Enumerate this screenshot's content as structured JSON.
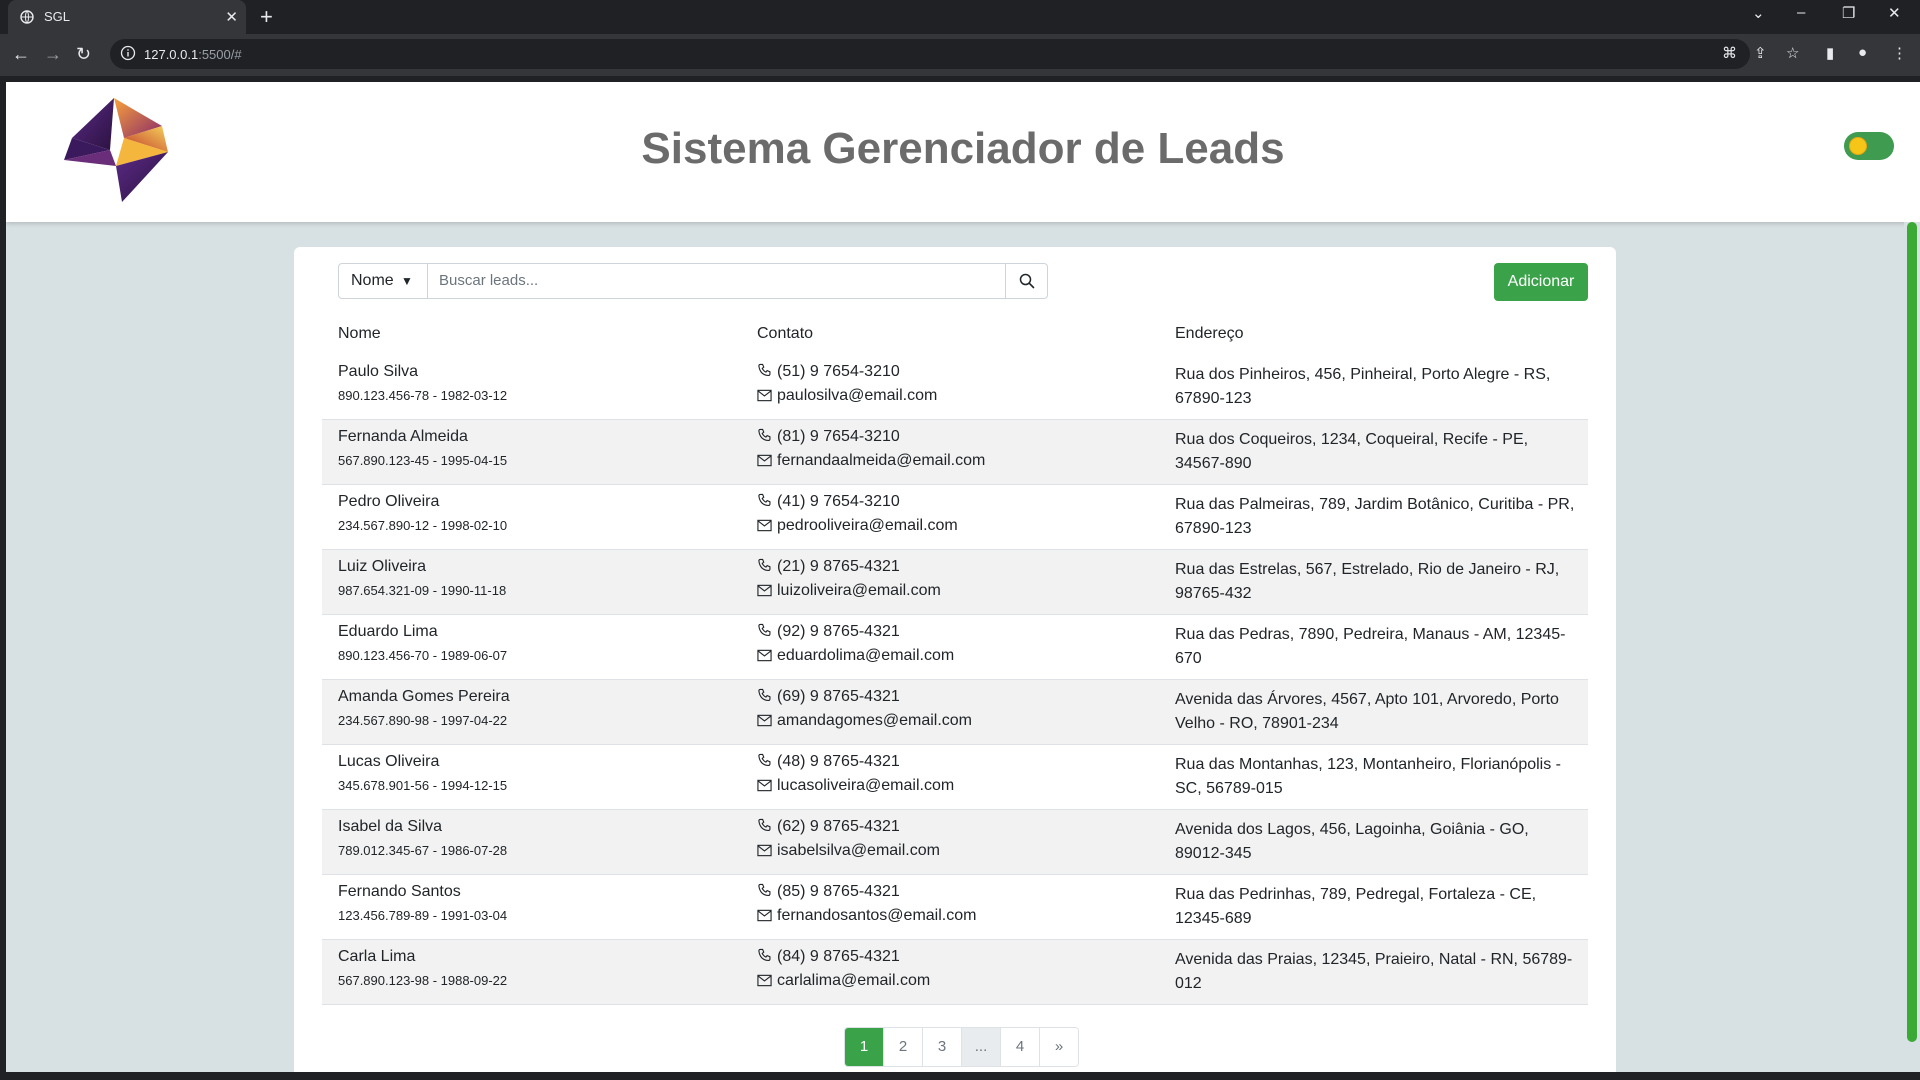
{
  "browser": {
    "tab_title": "SGL",
    "tab_close": "✕",
    "new_tab": "+",
    "url_host": "127.0.0.1",
    "url_rest": ":5500/#"
  },
  "header": {
    "title": "Sistema Gerenciador de Leads"
  },
  "search": {
    "filter_label": "Nome",
    "placeholder": "Buscar leads...",
    "value": ""
  },
  "actions": {
    "add_label": "Adicionar"
  },
  "table": {
    "columns": [
      "Nome",
      "Contato",
      "Endereço"
    ],
    "rows": [
      {
        "name": "Paulo Silva",
        "sub": "890.123.456-78 - 1982-03-12",
        "phone": "(51) 9 7654-3210",
        "email": "paulosilva@email.com",
        "address": "Rua dos Pinheiros, 456, Pinheiral, Porto Alegre - RS, 67890-123"
      },
      {
        "name": "Fernanda Almeida",
        "sub": "567.890.123-45 - 1995-04-15",
        "phone": "(81) 9 7654-3210",
        "email": "fernandaalmeida@email.com",
        "address": "Rua dos Coqueiros, 1234, Coqueiral, Recife - PE, 34567-890"
      },
      {
        "name": "Pedro Oliveira",
        "sub": "234.567.890-12 - 1998-02-10",
        "phone": "(41) 9 7654-3210",
        "email": "pedrooliveira@email.com",
        "address": "Rua das Palmeiras, 789, Jardim Botânico, Curitiba - PR, 67890-123"
      },
      {
        "name": "Luiz Oliveira",
        "sub": "987.654.321-09 - 1990-11-18",
        "phone": "(21) 9 8765-4321",
        "email": "luizoliveira@email.com",
        "address": "Rua das Estrelas, 567, Estrelado, Rio de Janeiro - RJ, 98765-432"
      },
      {
        "name": "Eduardo Lima",
        "sub": "890.123.456-70 - 1989-06-07",
        "phone": "(92) 9 8765-4321",
        "email": "eduardolima@email.com",
        "address": "Rua das Pedras, 7890, Pedreira, Manaus - AM, 12345-670"
      },
      {
        "name": "Amanda Gomes Pereira",
        "sub": "234.567.890-98 - 1997-04-22",
        "phone": "(69) 9 8765-4321",
        "email": "amandagomes@email.com",
        "address": "Avenida das Árvores, 4567, Apto 101, Arvoredo, Porto Velho - RO, 78901-234"
      },
      {
        "name": "Lucas Oliveira",
        "sub": "345.678.901-56 - 1994-12-15",
        "phone": "(48) 9 8765-4321",
        "email": "lucasoliveira@email.com",
        "address": "Rua das Montanhas, 123, Montanheiro, Florianópolis - SC, 56789-015"
      },
      {
        "name": "Isabel da Silva",
        "sub": "789.012.345-67 - 1986-07-28",
        "phone": "(62) 9 8765-4321",
        "email": "isabelsilva@email.com",
        "address": "Avenida dos Lagos, 456, Lagoinha, Goiânia - GO, 89012-345"
      },
      {
        "name": "Fernando Santos",
        "sub": "123.456.789-89 - 1991-03-04",
        "phone": "(85) 9 8765-4321",
        "email": "fernandosantos@email.com",
        "address": "Rua das Pedrinhas, 789, Pedregal, Fortaleza - CE, 12345-689"
      },
      {
        "name": "Carla Lima",
        "sub": "567.890.123-98 - 1988-09-22",
        "phone": "(84) 9 8765-4321",
        "email": "carlalima@email.com",
        "address": "Avenida das Praias, 12345, Praieiro, Natal - RN, 56789-012"
      }
    ]
  },
  "pagination": {
    "pages": [
      "1",
      "2",
      "3",
      "...",
      "4",
      "»"
    ],
    "active": "1"
  },
  "colors": {
    "accent_green": "#3aa34a",
    "title_gray": "#6b6b6b",
    "page_bg": "#d7e0e3"
  }
}
